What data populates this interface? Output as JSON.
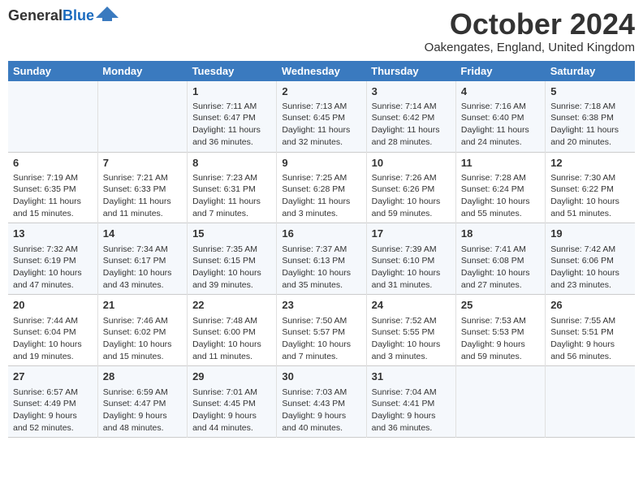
{
  "header": {
    "logo_general": "General",
    "logo_blue": "Blue",
    "month_title": "October 2024",
    "location": "Oakengates, England, United Kingdom"
  },
  "days_of_week": [
    "Sunday",
    "Monday",
    "Tuesday",
    "Wednesday",
    "Thursday",
    "Friday",
    "Saturday"
  ],
  "weeks": [
    [
      {
        "day": "",
        "info": ""
      },
      {
        "day": "",
        "info": ""
      },
      {
        "day": "1",
        "info": "Sunrise: 7:11 AM\nSunset: 6:47 PM\nDaylight: 11 hours and 36 minutes."
      },
      {
        "day": "2",
        "info": "Sunrise: 7:13 AM\nSunset: 6:45 PM\nDaylight: 11 hours and 32 minutes."
      },
      {
        "day": "3",
        "info": "Sunrise: 7:14 AM\nSunset: 6:42 PM\nDaylight: 11 hours and 28 minutes."
      },
      {
        "day": "4",
        "info": "Sunrise: 7:16 AM\nSunset: 6:40 PM\nDaylight: 11 hours and 24 minutes."
      },
      {
        "day": "5",
        "info": "Sunrise: 7:18 AM\nSunset: 6:38 PM\nDaylight: 11 hours and 20 minutes."
      }
    ],
    [
      {
        "day": "6",
        "info": "Sunrise: 7:19 AM\nSunset: 6:35 PM\nDaylight: 11 hours and 15 minutes."
      },
      {
        "day": "7",
        "info": "Sunrise: 7:21 AM\nSunset: 6:33 PM\nDaylight: 11 hours and 11 minutes."
      },
      {
        "day": "8",
        "info": "Sunrise: 7:23 AM\nSunset: 6:31 PM\nDaylight: 11 hours and 7 minutes."
      },
      {
        "day": "9",
        "info": "Sunrise: 7:25 AM\nSunset: 6:28 PM\nDaylight: 11 hours and 3 minutes."
      },
      {
        "day": "10",
        "info": "Sunrise: 7:26 AM\nSunset: 6:26 PM\nDaylight: 10 hours and 59 minutes."
      },
      {
        "day": "11",
        "info": "Sunrise: 7:28 AM\nSunset: 6:24 PM\nDaylight: 10 hours and 55 minutes."
      },
      {
        "day": "12",
        "info": "Sunrise: 7:30 AM\nSunset: 6:22 PM\nDaylight: 10 hours and 51 minutes."
      }
    ],
    [
      {
        "day": "13",
        "info": "Sunrise: 7:32 AM\nSunset: 6:19 PM\nDaylight: 10 hours and 47 minutes."
      },
      {
        "day": "14",
        "info": "Sunrise: 7:34 AM\nSunset: 6:17 PM\nDaylight: 10 hours and 43 minutes."
      },
      {
        "day": "15",
        "info": "Sunrise: 7:35 AM\nSunset: 6:15 PM\nDaylight: 10 hours and 39 minutes."
      },
      {
        "day": "16",
        "info": "Sunrise: 7:37 AM\nSunset: 6:13 PM\nDaylight: 10 hours and 35 minutes."
      },
      {
        "day": "17",
        "info": "Sunrise: 7:39 AM\nSunset: 6:10 PM\nDaylight: 10 hours and 31 minutes."
      },
      {
        "day": "18",
        "info": "Sunrise: 7:41 AM\nSunset: 6:08 PM\nDaylight: 10 hours and 27 minutes."
      },
      {
        "day": "19",
        "info": "Sunrise: 7:42 AM\nSunset: 6:06 PM\nDaylight: 10 hours and 23 minutes."
      }
    ],
    [
      {
        "day": "20",
        "info": "Sunrise: 7:44 AM\nSunset: 6:04 PM\nDaylight: 10 hours and 19 minutes."
      },
      {
        "day": "21",
        "info": "Sunrise: 7:46 AM\nSunset: 6:02 PM\nDaylight: 10 hours and 15 minutes."
      },
      {
        "day": "22",
        "info": "Sunrise: 7:48 AM\nSunset: 6:00 PM\nDaylight: 10 hours and 11 minutes."
      },
      {
        "day": "23",
        "info": "Sunrise: 7:50 AM\nSunset: 5:57 PM\nDaylight: 10 hours and 7 minutes."
      },
      {
        "day": "24",
        "info": "Sunrise: 7:52 AM\nSunset: 5:55 PM\nDaylight: 10 hours and 3 minutes."
      },
      {
        "day": "25",
        "info": "Sunrise: 7:53 AM\nSunset: 5:53 PM\nDaylight: 9 hours and 59 minutes."
      },
      {
        "day": "26",
        "info": "Sunrise: 7:55 AM\nSunset: 5:51 PM\nDaylight: 9 hours and 56 minutes."
      }
    ],
    [
      {
        "day": "27",
        "info": "Sunrise: 6:57 AM\nSunset: 4:49 PM\nDaylight: 9 hours and 52 minutes."
      },
      {
        "day": "28",
        "info": "Sunrise: 6:59 AM\nSunset: 4:47 PM\nDaylight: 9 hours and 48 minutes."
      },
      {
        "day": "29",
        "info": "Sunrise: 7:01 AM\nSunset: 4:45 PM\nDaylight: 9 hours and 44 minutes."
      },
      {
        "day": "30",
        "info": "Sunrise: 7:03 AM\nSunset: 4:43 PM\nDaylight: 9 hours and 40 minutes."
      },
      {
        "day": "31",
        "info": "Sunrise: 7:04 AM\nSunset: 4:41 PM\nDaylight: 9 hours and 36 minutes."
      },
      {
        "day": "",
        "info": ""
      },
      {
        "day": "",
        "info": ""
      }
    ]
  ]
}
